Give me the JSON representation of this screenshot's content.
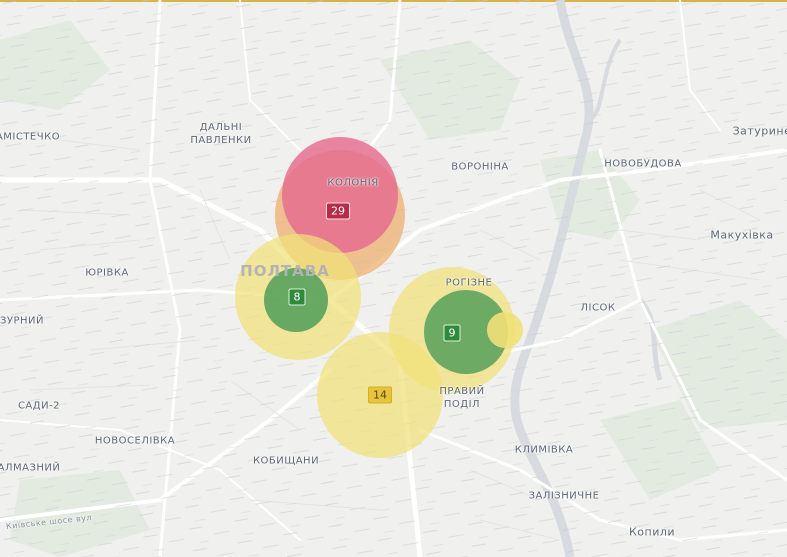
{
  "map": {
    "places": {
      "zamistechko": "АМІСТЕЧКО",
      "dalni_pavlenky": [
        "ДАЛЬНІ",
        "ПАВЛЕНКИ"
      ],
      "koloniia": "КОЛОНІЯ",
      "voronina": "ВОРОНІНА",
      "novobudova": "НОВОБУДОВА",
      "zaturyne": "Затурине",
      "makukhivka": "Макухівка",
      "yurivka": "ЮРІВКА",
      "poltava": "ПОЛТАВА",
      "rohizne": "РОГІЗНЕ",
      "lisok": "ЛІСОК",
      "zurnyi": "ЗУРНИЙ",
      "pravyi_podil": [
        "ПРАВИЙ",
        "ПОДІЛ"
      ],
      "sady2": "САДИ-2",
      "novoselivka": "НОВОСЕЛІВКА",
      "klymivka": "КЛИМІВКА",
      "kobyshchany": "КОБИЩАНИ",
      "almaznyi": "АЛМАЗНИЙ",
      "zaliznychne": "ЗАЛІЗНИЧНЕ",
      "kopyli": "Копили",
      "kyivske_shose": "Київське шосе вул"
    },
    "clusters": [
      {
        "count": "29",
        "level": "high",
        "color": "#b92a4a"
      },
      {
        "count": "8",
        "level": "low",
        "color": "#2f8a3a"
      },
      {
        "count": "9",
        "level": "low",
        "color": "#2f8a3a"
      },
      {
        "count": "14",
        "level": "medium",
        "color": "#e8c43a"
      }
    ],
    "colors": {
      "zone_red": "#e56a8f",
      "zone_orange": "#eeb070",
      "zone_yellow": "#f1e078",
      "zone_green": "#4f9e58",
      "accent": "#d9b24a"
    }
  }
}
